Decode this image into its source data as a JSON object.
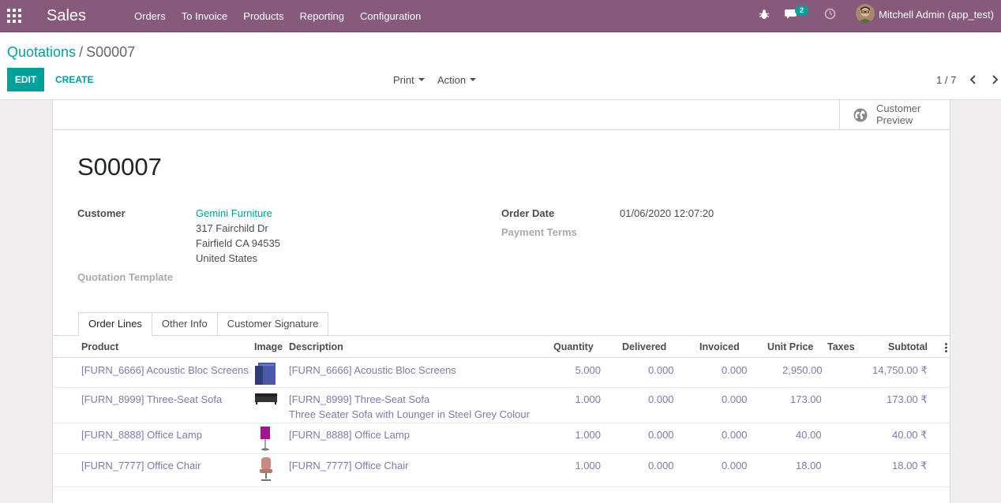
{
  "navbar": {
    "app_name": "Sales",
    "menu": [
      "Orders",
      "To Invoice",
      "Products",
      "Reporting",
      "Configuration"
    ],
    "chat_badge": "2",
    "user": "Mitchell Admin (app_test)",
    "color": "#875a7b"
  },
  "control": {
    "breadcrumb_parent": "Quotations",
    "breadcrumb_sep": "/",
    "breadcrumb_current": "S00007",
    "edit_label": "EDIT",
    "create_label": "CREATE",
    "print_label": "Print",
    "action_label": "Action",
    "pager": "1 / 7",
    "accent": "#00a09d"
  },
  "sheet": {
    "preview_label": "Customer Preview",
    "title": "S00007",
    "customer_label": "Customer",
    "customer_name": "Gemini Furniture",
    "address_line1": "317 Fairchild Dr",
    "address_line2": "Fairfield CA 94535",
    "address_line3": "United States",
    "quotation_template_label": "Quotation Template",
    "order_date_label": "Order Date",
    "order_date": "01/06/2020 12:07:20",
    "payment_terms_label": "Payment Terms"
  },
  "tabs": [
    "Order Lines",
    "Other Info",
    "Customer Signature"
  ],
  "table": {
    "headers": {
      "product": "Product",
      "image": "Image",
      "description": "Description",
      "quantity": "Quantity",
      "delivered": "Delivered",
      "invoiced": "Invoiced",
      "unit_price": "Unit Price",
      "taxes": "Taxes",
      "subtotal": "Subtotal"
    },
    "rows": [
      {
        "product": "[FURN_6666] Acoustic Bloc Screens",
        "description": "[FURN_6666] Acoustic Bloc Screens",
        "description2": "",
        "quantity": "5.000",
        "delivered": "0.000",
        "invoiced": "0.000",
        "unit_price": "2,950.00",
        "subtotal": "14,750.00 ₹",
        "image": "screen-thumbnail"
      },
      {
        "product": "[FURN_8999] Three-Seat Sofa",
        "description": "[FURN_8999] Three-Seat Sofa",
        "description2": "Three Seater Sofa with Lounger in Steel Grey Colour",
        "quantity": "1.000",
        "delivered": "0.000",
        "invoiced": "0.000",
        "unit_price": "173.00",
        "subtotal": "173.00 ₹",
        "image": "sofa-thumbnail"
      },
      {
        "product": "[FURN_8888] Office Lamp",
        "description": "[FURN_8888] Office Lamp",
        "description2": "",
        "quantity": "1.000",
        "delivered": "0.000",
        "invoiced": "0.000",
        "unit_price": "40.00",
        "subtotal": "40.00 ₹",
        "image": "lamp-thumbnail"
      },
      {
        "product": "[FURN_7777] Office Chair",
        "description": "[FURN_7777] Office Chair",
        "description2": "",
        "quantity": "1.000",
        "delivered": "0.000",
        "invoiced": "0.000",
        "unit_price": "18.00",
        "subtotal": "18.00 ₹",
        "image": "chair-thumbnail"
      }
    ]
  }
}
